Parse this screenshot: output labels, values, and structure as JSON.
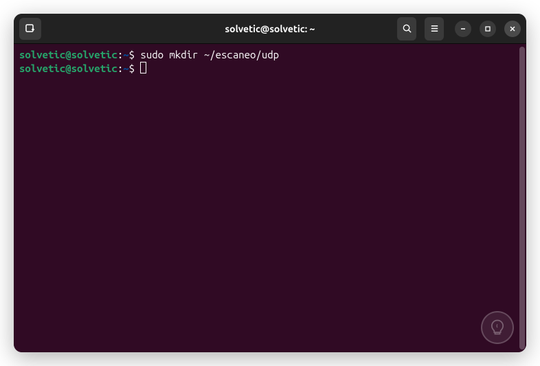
{
  "window": {
    "title": "solvetic@solvetic: ~"
  },
  "terminal": {
    "lines": [
      {
        "user_host": "solvetic@solvetic",
        "separator": ":",
        "path": "~",
        "prompt": "$",
        "command": " sudo mkdir ~/escaneo/udp"
      },
      {
        "user_host": "solvetic@solvetic",
        "separator": ":",
        "path": "~",
        "prompt": "$",
        "command": " "
      }
    ]
  }
}
